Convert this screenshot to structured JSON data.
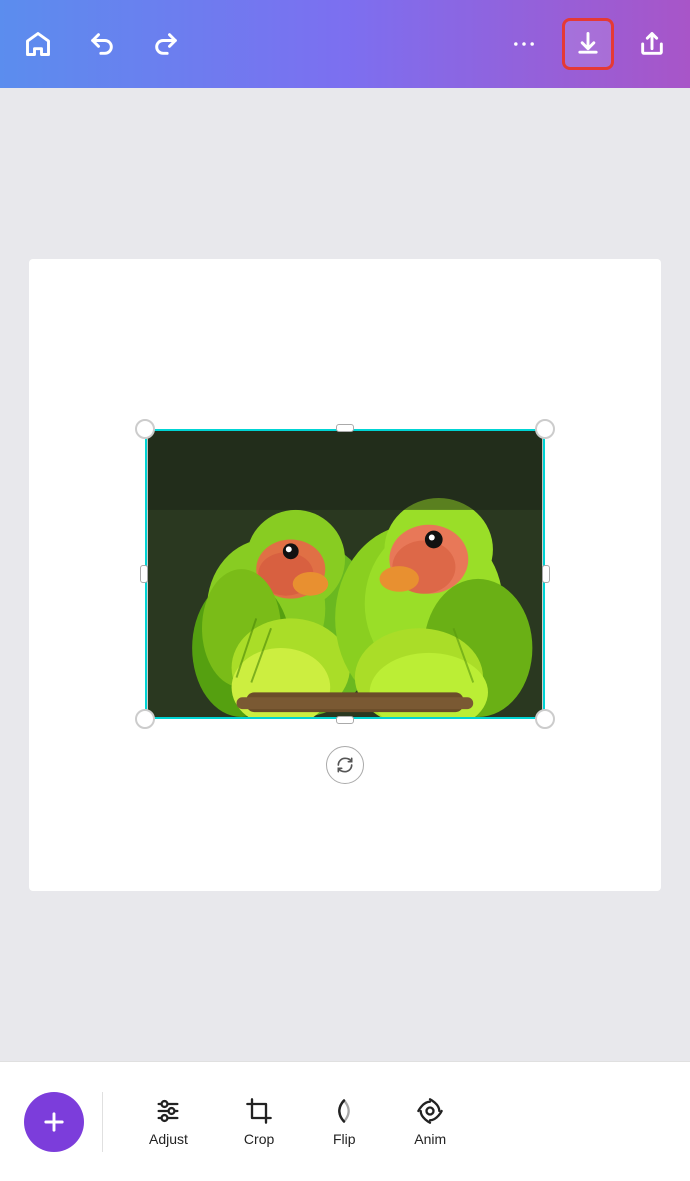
{
  "toolbar": {
    "home_label": "Home",
    "undo_label": "Undo",
    "redo_label": "Redo",
    "more_label": "More options",
    "download_label": "Download",
    "share_label": "Share"
  },
  "canvas": {
    "bg_color": "#ffffff"
  },
  "rotate_handle_label": "Rotate",
  "bottom_tools": {
    "add_label": "+",
    "adjust_label": "Adjust",
    "crop_label": "Crop",
    "flip_label": "Flip",
    "anim_label": "Anim"
  }
}
